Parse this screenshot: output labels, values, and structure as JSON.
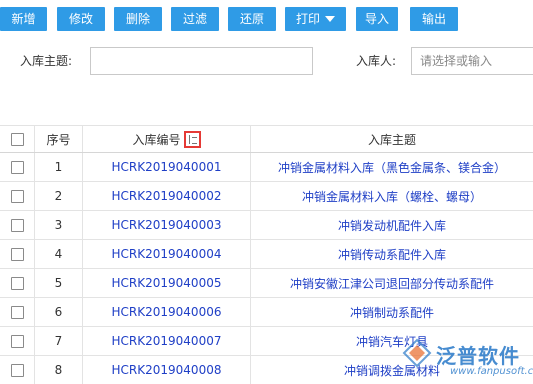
{
  "toolbar": {
    "buttons": [
      {
        "label": "新增"
      },
      {
        "label": "修改"
      },
      {
        "label": "删除"
      },
      {
        "label": "过滤"
      },
      {
        "label": "还原"
      },
      {
        "label": "打印"
      },
      {
        "label": "导入"
      },
      {
        "label": "输出"
      }
    ]
  },
  "filters": {
    "subject_label": "入库主题:",
    "subject_value": "",
    "person_label": "入库人:",
    "person_placeholder": "请选择或输入"
  },
  "table": {
    "headers": {
      "seq": "序号",
      "code": "入库编号",
      "subject": "入库主题"
    },
    "rows": [
      {
        "seq": "1",
        "code": "HCRK2019040001",
        "subject": "冲销金属材料入库（黑色金属条、镁合金）"
      },
      {
        "seq": "2",
        "code": "HCRK2019040002",
        "subject": "冲销金属材料入库（螺栓、螺母）"
      },
      {
        "seq": "3",
        "code": "HCRK2019040003",
        "subject": "冲销发动机配件入库"
      },
      {
        "seq": "4",
        "code": "HCRK2019040004",
        "subject": "冲销传动系配件入库"
      },
      {
        "seq": "5",
        "code": "HCRK2019040005",
        "subject": "冲销安徽江津公司退回部分传动系配件"
      },
      {
        "seq": "6",
        "code": "HCRK2019040006",
        "subject": "冲销制动系配件"
      },
      {
        "seq": "7",
        "code": "HCRK2019040007",
        "subject": "冲销汽车灯具"
      },
      {
        "seq": "8",
        "code": "HCRK2019040008",
        "subject": "冲销调拨金属材料"
      }
    ]
  },
  "watermark": {
    "name": "泛普软件",
    "url": "www.fanpusoft.com"
  },
  "colors": {
    "button_bg": "#2f9be6",
    "link": "#1f3fc6",
    "sort_highlight": "#e53935",
    "watermark": "#2878c8"
  }
}
